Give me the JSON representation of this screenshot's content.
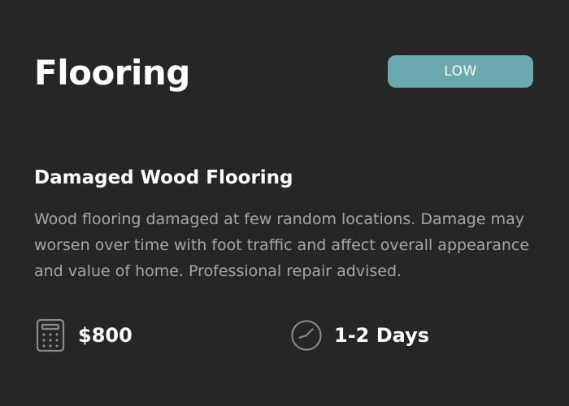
{
  "header": {
    "title": "Flooring",
    "severity_label": "LOW"
  },
  "issue": {
    "title": "Damaged Wood Flooring",
    "description": "Wood flooring damaged at few random locations. Damage may worsen over time with foot traffic and affect overall appearance and value of home. Professional repair advised."
  },
  "estimate": {
    "cost": "$800",
    "cost_icon": "calculator-icon",
    "duration": "1-2 Days",
    "duration_icon": "clock-icon"
  },
  "colors": {
    "background": "#262626",
    "badge": "#6aa9ad",
    "text_primary": "#ffffff",
    "text_secondary": "#a6a6a6",
    "icon_stroke": "#8a8a8a"
  }
}
